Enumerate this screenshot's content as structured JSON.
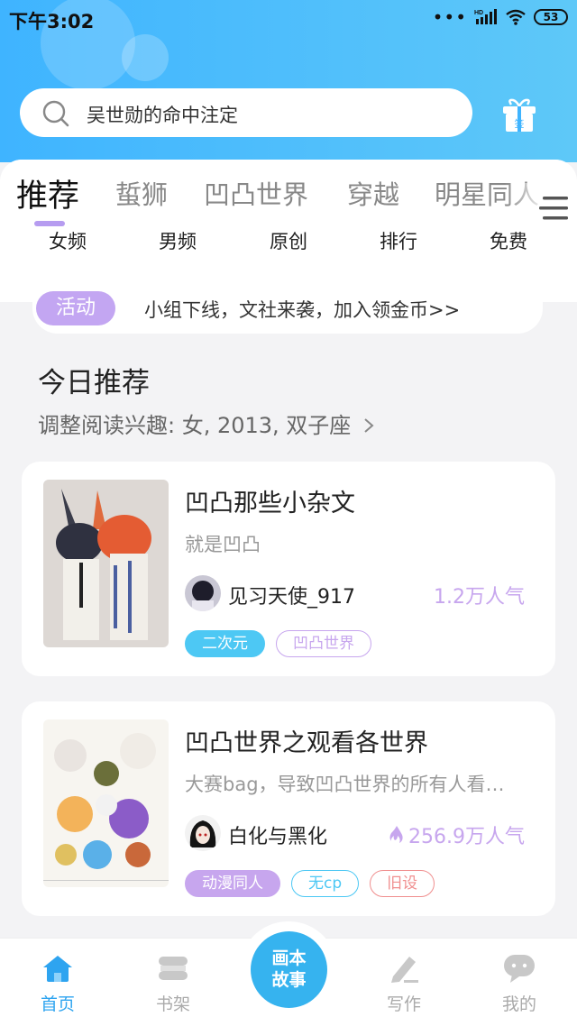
{
  "status_bar": {
    "time": "下午3:02",
    "battery": "53",
    "network_label": "HD"
  },
  "search": {
    "placeholder_text": "吴世勋的命中注定"
  },
  "tabs": [
    {
      "label": "推荐",
      "active": true
    },
    {
      "label": "蜇狮",
      "active": false
    },
    {
      "label": "凹凸世界",
      "active": false
    },
    {
      "label": "穿越",
      "active": false
    },
    {
      "label": "明星同人",
      "active": false
    }
  ],
  "subtabs": [
    "女频",
    "男频",
    "原创",
    "排行",
    "免费"
  ],
  "activity": {
    "badge": "活动",
    "text": "小组下线，文社来袭，加入领金币>>"
  },
  "section": {
    "title": "今日推荐",
    "subtitle": "调整阅读兴趣: 女, 2013, 双子座"
  },
  "books": [
    {
      "title": "凹凸那些小杂文",
      "desc": "就是凹凸",
      "author": "见习天使_917",
      "popularity": "1.2万人气",
      "tags": [
        "二次元",
        "凹凸世界"
      ]
    },
    {
      "title": "凹凸世界之观看各世界",
      "desc": "大赛bag，导致凹凸世界的所有人看…",
      "author": "白化与黑化",
      "popularity": "256.9万人气",
      "tags": [
        "动漫同人",
        "无cp",
        "旧设"
      ]
    }
  ],
  "bottom_nav": {
    "home": "首页",
    "shelf": "书架",
    "center_line1": "画本",
    "center_line2": "故事",
    "write": "写作",
    "me": "我的"
  },
  "colors": {
    "accent_blue": "#36b3ef",
    "accent_purple": "#c7a6ee",
    "header_blue": "#3fb4ff"
  }
}
